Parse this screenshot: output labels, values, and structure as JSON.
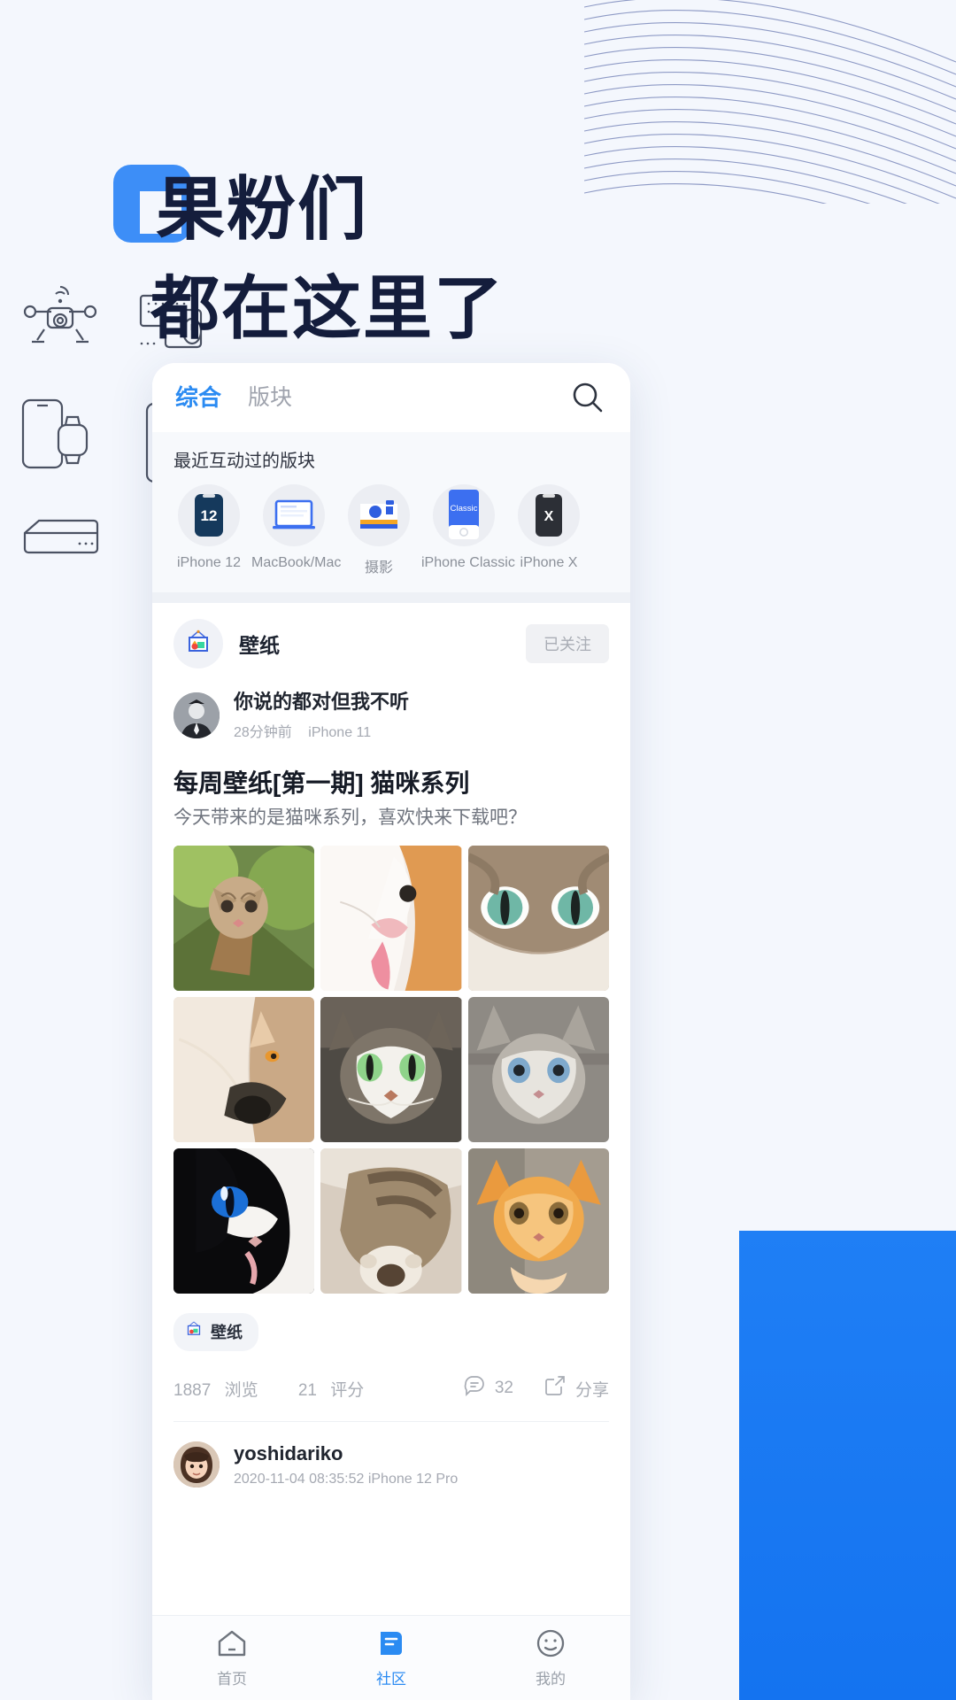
{
  "hero": {
    "logo_icon": "app-logo-square",
    "line1": "果粉们",
    "line2": "都在这里了",
    "text_color": "#141d3c",
    "logo_color": "#3d8ef7",
    "background_color": "#f4f7fd",
    "accent_block_color": "#1f7ff5"
  },
  "app": {
    "tabs": [
      {
        "label": "综合",
        "active": true
      },
      {
        "label": "版块",
        "active": false
      }
    ],
    "active_tab_color": "#2b8bf2",
    "search_icon": "search-icon",
    "recent": {
      "title": "最近互动过的版块",
      "boards": [
        {
          "label": "iPhone 12",
          "icon": "iphone-12-icon"
        },
        {
          "label": "MacBook/Mac",
          "icon": "macbook-icon"
        },
        {
          "label": "摄影",
          "icon": "polaroid-camera-icon"
        },
        {
          "label": "iPhone Classic",
          "icon": "iphone-classic-icon"
        },
        {
          "label": "iPhone X",
          "icon": "iphone-x-icon"
        }
      ]
    },
    "post": {
      "board": {
        "name": "壁纸",
        "icon": "wallpaper-frame-icon",
        "follow_label": "已关注"
      },
      "author": {
        "name": "你说的都对但我不听",
        "time": "28分钟前",
        "device": "iPhone 11",
        "avatar": "avatar-man"
      },
      "title": "每周壁纸[第一期] 猫咪系列",
      "body": "今天带来的是猫咪系列，喜欢快来下载吧？",
      "images": [
        {
          "alt": "kitten-on-branch"
        },
        {
          "alt": "orange-white-cat-tongue"
        },
        {
          "alt": "green-eyed-tabby-closeup"
        },
        {
          "alt": "fluffy-cream-cat"
        },
        {
          "alt": "grey-tabby-green-eyes"
        },
        {
          "alt": "grey-kitten-blue-eyes"
        },
        {
          "alt": "black-white-cat-blue-eye"
        },
        {
          "alt": "tabby-cat-paw"
        },
        {
          "alt": "ginger-kitten"
        }
      ],
      "tag": {
        "label": "壁纸",
        "icon": "wallpaper-frame-icon"
      },
      "stats": {
        "views_count": "1887",
        "views_label": "浏览",
        "rating_count": "21",
        "rating_label": "评分",
        "comment_count": "32",
        "comment_icon": "comment-icon",
        "share_label": "分享",
        "share_icon": "share-icon"
      }
    },
    "next_post": {
      "name": "yoshidariko",
      "meta": "2020-11-04 08:35:52 iPhone 12 Pro",
      "avatar": "avatar-woman"
    },
    "bottom_nav": [
      {
        "label": "首页",
        "icon": "home-icon",
        "active": false
      },
      {
        "label": "社区",
        "icon": "community-icon",
        "active": true
      },
      {
        "label": "我的",
        "icon": "profile-icon",
        "active": false
      }
    ]
  }
}
